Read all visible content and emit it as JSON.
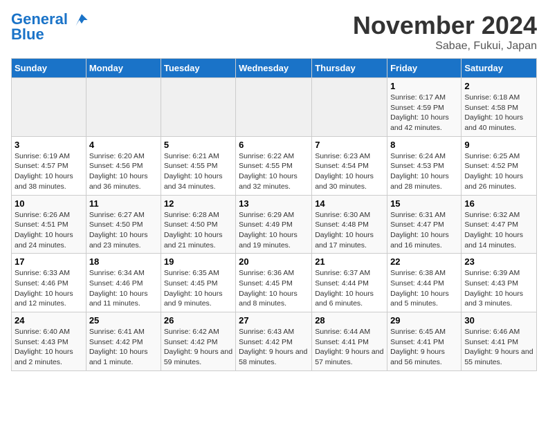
{
  "header": {
    "logo_line1": "General",
    "logo_line2": "Blue",
    "month": "November 2024",
    "location": "Sabae, Fukui, Japan"
  },
  "weekdays": [
    "Sunday",
    "Monday",
    "Tuesday",
    "Wednesday",
    "Thursday",
    "Friday",
    "Saturday"
  ],
  "weeks": [
    [
      {
        "day": "",
        "info": ""
      },
      {
        "day": "",
        "info": ""
      },
      {
        "day": "",
        "info": ""
      },
      {
        "day": "",
        "info": ""
      },
      {
        "day": "",
        "info": ""
      },
      {
        "day": "1",
        "info": "Sunrise: 6:17 AM\nSunset: 4:59 PM\nDaylight: 10 hours and 42 minutes."
      },
      {
        "day": "2",
        "info": "Sunrise: 6:18 AM\nSunset: 4:58 PM\nDaylight: 10 hours and 40 minutes."
      }
    ],
    [
      {
        "day": "3",
        "info": "Sunrise: 6:19 AM\nSunset: 4:57 PM\nDaylight: 10 hours and 38 minutes."
      },
      {
        "day": "4",
        "info": "Sunrise: 6:20 AM\nSunset: 4:56 PM\nDaylight: 10 hours and 36 minutes."
      },
      {
        "day": "5",
        "info": "Sunrise: 6:21 AM\nSunset: 4:55 PM\nDaylight: 10 hours and 34 minutes."
      },
      {
        "day": "6",
        "info": "Sunrise: 6:22 AM\nSunset: 4:55 PM\nDaylight: 10 hours and 32 minutes."
      },
      {
        "day": "7",
        "info": "Sunrise: 6:23 AM\nSunset: 4:54 PM\nDaylight: 10 hours and 30 minutes."
      },
      {
        "day": "8",
        "info": "Sunrise: 6:24 AM\nSunset: 4:53 PM\nDaylight: 10 hours and 28 minutes."
      },
      {
        "day": "9",
        "info": "Sunrise: 6:25 AM\nSunset: 4:52 PM\nDaylight: 10 hours and 26 minutes."
      }
    ],
    [
      {
        "day": "10",
        "info": "Sunrise: 6:26 AM\nSunset: 4:51 PM\nDaylight: 10 hours and 24 minutes."
      },
      {
        "day": "11",
        "info": "Sunrise: 6:27 AM\nSunset: 4:50 PM\nDaylight: 10 hours and 23 minutes."
      },
      {
        "day": "12",
        "info": "Sunrise: 6:28 AM\nSunset: 4:50 PM\nDaylight: 10 hours and 21 minutes."
      },
      {
        "day": "13",
        "info": "Sunrise: 6:29 AM\nSunset: 4:49 PM\nDaylight: 10 hours and 19 minutes."
      },
      {
        "day": "14",
        "info": "Sunrise: 6:30 AM\nSunset: 4:48 PM\nDaylight: 10 hours and 17 minutes."
      },
      {
        "day": "15",
        "info": "Sunrise: 6:31 AM\nSunset: 4:47 PM\nDaylight: 10 hours and 16 minutes."
      },
      {
        "day": "16",
        "info": "Sunrise: 6:32 AM\nSunset: 4:47 PM\nDaylight: 10 hours and 14 minutes."
      }
    ],
    [
      {
        "day": "17",
        "info": "Sunrise: 6:33 AM\nSunset: 4:46 PM\nDaylight: 10 hours and 12 minutes."
      },
      {
        "day": "18",
        "info": "Sunrise: 6:34 AM\nSunset: 4:46 PM\nDaylight: 10 hours and 11 minutes."
      },
      {
        "day": "19",
        "info": "Sunrise: 6:35 AM\nSunset: 4:45 PM\nDaylight: 10 hours and 9 minutes."
      },
      {
        "day": "20",
        "info": "Sunrise: 6:36 AM\nSunset: 4:45 PM\nDaylight: 10 hours and 8 minutes."
      },
      {
        "day": "21",
        "info": "Sunrise: 6:37 AM\nSunset: 4:44 PM\nDaylight: 10 hours and 6 minutes."
      },
      {
        "day": "22",
        "info": "Sunrise: 6:38 AM\nSunset: 4:44 PM\nDaylight: 10 hours and 5 minutes."
      },
      {
        "day": "23",
        "info": "Sunrise: 6:39 AM\nSunset: 4:43 PM\nDaylight: 10 hours and 3 minutes."
      }
    ],
    [
      {
        "day": "24",
        "info": "Sunrise: 6:40 AM\nSunset: 4:43 PM\nDaylight: 10 hours and 2 minutes."
      },
      {
        "day": "25",
        "info": "Sunrise: 6:41 AM\nSunset: 4:42 PM\nDaylight: 10 hours and 1 minute."
      },
      {
        "day": "26",
        "info": "Sunrise: 6:42 AM\nSunset: 4:42 PM\nDaylight: 9 hours and 59 minutes."
      },
      {
        "day": "27",
        "info": "Sunrise: 6:43 AM\nSunset: 4:42 PM\nDaylight: 9 hours and 58 minutes."
      },
      {
        "day": "28",
        "info": "Sunrise: 6:44 AM\nSunset: 4:41 PM\nDaylight: 9 hours and 57 minutes."
      },
      {
        "day": "29",
        "info": "Sunrise: 6:45 AM\nSunset: 4:41 PM\nDaylight: 9 hours and 56 minutes."
      },
      {
        "day": "30",
        "info": "Sunrise: 6:46 AM\nSunset: 4:41 PM\nDaylight: 9 hours and 55 minutes."
      }
    ]
  ]
}
